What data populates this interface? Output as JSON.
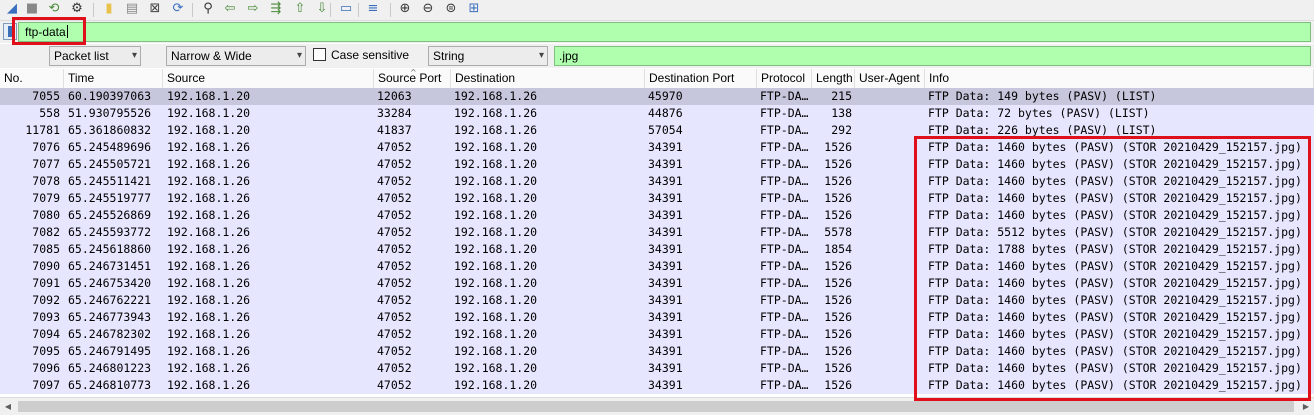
{
  "toolbar": {
    "icons": [
      {
        "name": "shark-fin-start-icon",
        "glyph": "◢",
        "color": "#3a6fbf"
      },
      {
        "name": "stop-capture-icon",
        "glyph": "■",
        "color": "#888888"
      },
      {
        "name": "restart-capture-icon",
        "glyph": "⟲",
        "color": "#4a8a3a"
      },
      {
        "name": "capture-options-icon",
        "glyph": "⚙",
        "color": "#333333"
      },
      {
        "name": "open-file-icon",
        "glyph": "▮",
        "color": "#e8c24a"
      },
      {
        "name": "save-file-icon",
        "glyph": "▤",
        "color": "#888888"
      },
      {
        "name": "close-file-icon",
        "glyph": "⊠",
        "color": "#444444"
      },
      {
        "name": "reload-file-icon",
        "glyph": "⟳",
        "color": "#3a6fbf"
      },
      {
        "name": "find-packet-icon",
        "glyph": "⚲",
        "color": "#333333"
      },
      {
        "name": "go-back-icon",
        "glyph": "⇦",
        "color": "#4a8a3a"
      },
      {
        "name": "go-forward-icon",
        "glyph": "⇨",
        "color": "#4a8a3a"
      },
      {
        "name": "go-to-packet-icon",
        "glyph": "⇶",
        "color": "#4a8a3a"
      },
      {
        "name": "go-first-packet-icon",
        "glyph": "⇧",
        "color": "#4a8a3a"
      },
      {
        "name": "go-last-packet-icon",
        "glyph": "⇩",
        "color": "#4a8a3a"
      },
      {
        "name": "auto-scroll-icon",
        "glyph": "▭",
        "color": "#3a6fbf"
      },
      {
        "name": "colorize-icon",
        "glyph": "≡",
        "color": "#3a6fbf"
      },
      {
        "name": "zoom-in-icon",
        "glyph": "⊕",
        "color": "#333333"
      },
      {
        "name": "zoom-out-icon",
        "glyph": "⊖",
        "color": "#333333"
      },
      {
        "name": "zoom-normal-icon",
        "glyph": "⊜",
        "color": "#333333"
      },
      {
        "name": "resize-columns-icon",
        "glyph": "⊞",
        "color": "#3a6fbf"
      }
    ]
  },
  "display_filter": {
    "value": "ftp-data"
  },
  "find_bar": {
    "search_in": "Packet list",
    "char_width": "Narrow & Wide",
    "case_sensitive_label": "Case sensitive",
    "search_type": "String",
    "search_value": ".jpg"
  },
  "columns": {
    "no": "No.",
    "time": "Time",
    "source": "Source",
    "source_port": "Source Port",
    "destination": "Destination",
    "destination_port": "Destination Port",
    "protocol": "Protocol",
    "length": "Length",
    "user_agent": "User-Agent",
    "info": "Info"
  },
  "packets": [
    {
      "no": "7055",
      "time": "60.190397063",
      "source": "192.168.1.20",
      "sport": "12063",
      "destination": "192.168.1.26",
      "dport": "45970",
      "protocol": "FTP-DA…",
      "length": "215",
      "user_agent": "",
      "info": "FTP Data: 149 bytes (PASV) (LIST)",
      "selected": true
    },
    {
      "no": "558",
      "time": "51.930795526",
      "source": "192.168.1.20",
      "sport": "33284",
      "destination": "192.168.1.26",
      "dport": "44876",
      "protocol": "FTP-DA…",
      "length": "138",
      "user_agent": "",
      "info": "FTP Data: 72 bytes (PASV) (LIST)"
    },
    {
      "no": "11781",
      "time": "65.361860832",
      "source": "192.168.1.20",
      "sport": "41837",
      "destination": "192.168.1.26",
      "dport": "57054",
      "protocol": "FTP-DA…",
      "length": "292",
      "user_agent": "",
      "info": "FTP Data: 226 bytes (PASV) (LIST)"
    },
    {
      "no": "7076",
      "time": "65.245489696",
      "source": "192.168.1.26",
      "sport": "47052",
      "destination": "192.168.1.20",
      "dport": "34391",
      "protocol": "FTP-DA…",
      "length": "1526",
      "user_agent": "",
      "info": "FTP Data: 1460 bytes (PASV) (STOR 20210429_152157.jpg)"
    },
    {
      "no": "7077",
      "time": "65.245505721",
      "source": "192.168.1.26",
      "sport": "47052",
      "destination": "192.168.1.20",
      "dport": "34391",
      "protocol": "FTP-DA…",
      "length": "1526",
      "user_agent": "",
      "info": "FTP Data: 1460 bytes (PASV) (STOR 20210429_152157.jpg)"
    },
    {
      "no": "7078",
      "time": "65.245511421",
      "source": "192.168.1.26",
      "sport": "47052",
      "destination": "192.168.1.20",
      "dport": "34391",
      "protocol": "FTP-DA…",
      "length": "1526",
      "user_agent": "",
      "info": "FTP Data: 1460 bytes (PASV) (STOR 20210429_152157.jpg)"
    },
    {
      "no": "7079",
      "time": "65.245519777",
      "source": "192.168.1.26",
      "sport": "47052",
      "destination": "192.168.1.20",
      "dport": "34391",
      "protocol": "FTP-DA…",
      "length": "1526",
      "user_agent": "",
      "info": "FTP Data: 1460 bytes (PASV) (STOR 20210429_152157.jpg)"
    },
    {
      "no": "7080",
      "time": "65.245526869",
      "source": "192.168.1.26",
      "sport": "47052",
      "destination": "192.168.1.20",
      "dport": "34391",
      "protocol": "FTP-DA…",
      "length": "1526",
      "user_agent": "",
      "info": "FTP Data: 1460 bytes (PASV) (STOR 20210429_152157.jpg)"
    },
    {
      "no": "7082",
      "time": "65.245593772",
      "source": "192.168.1.26",
      "sport": "47052",
      "destination": "192.168.1.20",
      "dport": "34391",
      "protocol": "FTP-DA…",
      "length": "5578",
      "user_agent": "",
      "info": "FTP Data: 5512 bytes (PASV) (STOR 20210429_152157.jpg)"
    },
    {
      "no": "7085",
      "time": "65.245618860",
      "source": "192.168.1.26",
      "sport": "47052",
      "destination": "192.168.1.20",
      "dport": "34391",
      "protocol": "FTP-DA…",
      "length": "1854",
      "user_agent": "",
      "info": "FTP Data: 1788 bytes (PASV) (STOR 20210429_152157.jpg)"
    },
    {
      "no": "7090",
      "time": "65.246731451",
      "source": "192.168.1.26",
      "sport": "47052",
      "destination": "192.168.1.20",
      "dport": "34391",
      "protocol": "FTP-DA…",
      "length": "1526",
      "user_agent": "",
      "info": "FTP Data: 1460 bytes (PASV) (STOR 20210429_152157.jpg)"
    },
    {
      "no": "7091",
      "time": "65.246753420",
      "source": "192.168.1.26",
      "sport": "47052",
      "destination": "192.168.1.20",
      "dport": "34391",
      "protocol": "FTP-DA…",
      "length": "1526",
      "user_agent": "",
      "info": "FTP Data: 1460 bytes (PASV) (STOR 20210429_152157.jpg)"
    },
    {
      "no": "7092",
      "time": "65.246762221",
      "source": "192.168.1.26",
      "sport": "47052",
      "destination": "192.168.1.20",
      "dport": "34391",
      "protocol": "FTP-DA…",
      "length": "1526",
      "user_agent": "",
      "info": "FTP Data: 1460 bytes (PASV) (STOR 20210429_152157.jpg)"
    },
    {
      "no": "7093",
      "time": "65.246773943",
      "source": "192.168.1.26",
      "sport": "47052",
      "destination": "192.168.1.20",
      "dport": "34391",
      "protocol": "FTP-DA…",
      "length": "1526",
      "user_agent": "",
      "info": "FTP Data: 1460 bytes (PASV) (STOR 20210429_152157.jpg)"
    },
    {
      "no": "7094",
      "time": "65.246782302",
      "source": "192.168.1.26",
      "sport": "47052",
      "destination": "192.168.1.20",
      "dport": "34391",
      "protocol": "FTP-DA…",
      "length": "1526",
      "user_agent": "",
      "info": "FTP Data: 1460 bytes (PASV) (STOR 20210429_152157.jpg)"
    },
    {
      "no": "7095",
      "time": "65.246791495",
      "source": "192.168.1.26",
      "sport": "47052",
      "destination": "192.168.1.20",
      "dport": "34391",
      "protocol": "FTP-DA…",
      "length": "1526",
      "user_agent": "",
      "info": "FTP Data: 1460 bytes (PASV) (STOR 20210429_152157.jpg)"
    },
    {
      "no": "7096",
      "time": "65.246801223",
      "source": "192.168.1.26",
      "sport": "47052",
      "destination": "192.168.1.20",
      "dport": "34391",
      "protocol": "FTP-DA…",
      "length": "1526",
      "user_agent": "",
      "info": "FTP Data: 1460 bytes (PASV) (STOR 20210429_152157.jpg)"
    },
    {
      "no": "7097",
      "time": "65.246810773",
      "source": "192.168.1.26",
      "sport": "47052",
      "destination": "192.168.1.20",
      "dport": "34391",
      "protocol": "FTP-DA…",
      "length": "1526",
      "user_agent": "",
      "info": "FTP Data: 1460 bytes (PASV) (STOR 20210429_152157.jpg)"
    }
  ],
  "colors": {
    "filter_valid": "#afffaf",
    "row_background": "#e7e6ff",
    "row_selected": "#c6c6dc",
    "annotation": "#e0101a"
  }
}
